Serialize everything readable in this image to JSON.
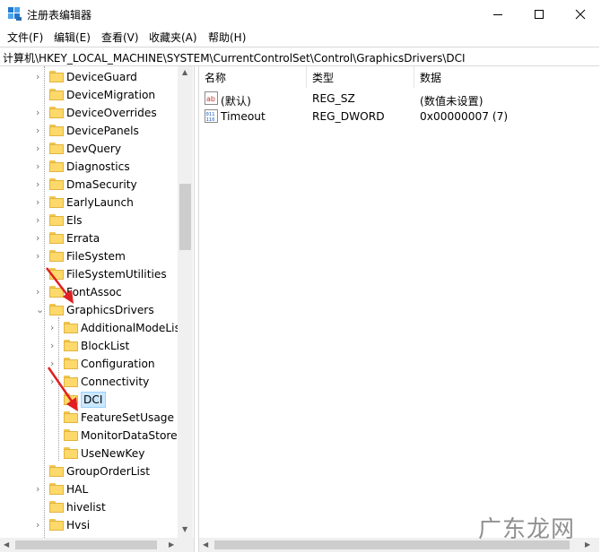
{
  "window": {
    "title": "注册表编辑器",
    "icon": "regedit-icon",
    "controls": [
      "minimize-icon",
      "maximize-icon",
      "close-icon"
    ]
  },
  "menu": [
    "文件(F)",
    "编辑(E)",
    "查看(V)",
    "收藏夹(A)",
    "帮助(H)"
  ],
  "address": "计算机\\HKEY_LOCAL_MACHINE\\SYSTEM\\CurrentControlSet\\Control\\GraphicsDrivers\\DCI",
  "tree": [
    {
      "label": "DeviceGuard",
      "level": 1,
      "expander": "collapsed"
    },
    {
      "label": "DeviceMigration",
      "level": 1,
      "expander": "none"
    },
    {
      "label": "DeviceOverrides",
      "level": 1,
      "expander": "collapsed"
    },
    {
      "label": "DevicePanels",
      "level": 1,
      "expander": "collapsed"
    },
    {
      "label": "DevQuery",
      "level": 1,
      "expander": "collapsed"
    },
    {
      "label": "Diagnostics",
      "level": 1,
      "expander": "collapsed"
    },
    {
      "label": "DmaSecurity",
      "level": 1,
      "expander": "collapsed"
    },
    {
      "label": "EarlyLaunch",
      "level": 1,
      "expander": "collapsed"
    },
    {
      "label": "Els",
      "level": 1,
      "expander": "collapsed"
    },
    {
      "label": "Errata",
      "level": 1,
      "expander": "collapsed"
    },
    {
      "label": "FileSystem",
      "level": 1,
      "expander": "collapsed"
    },
    {
      "label": "FileSystemUtilities",
      "level": 1,
      "expander": "none"
    },
    {
      "label": "FontAssoc",
      "level": 1,
      "expander": "collapsed"
    },
    {
      "label": "GraphicsDrivers",
      "level": 1,
      "expander": "expanded"
    },
    {
      "label": "AdditionalModeLis",
      "level": 2,
      "expander": "collapsed"
    },
    {
      "label": "BlockList",
      "level": 2,
      "expander": "collapsed"
    },
    {
      "label": "Configuration",
      "level": 2,
      "expander": "collapsed"
    },
    {
      "label": "Connectivity",
      "level": 2,
      "expander": "collapsed"
    },
    {
      "label": "DCI",
      "level": 2,
      "expander": "none",
      "selected": true
    },
    {
      "label": "FeatureSetUsage",
      "level": 2,
      "expander": "none"
    },
    {
      "label": "MonitorDataStore",
      "level": 2,
      "expander": "none"
    },
    {
      "label": "UseNewKey",
      "level": 2,
      "expander": "none"
    },
    {
      "label": "GroupOrderList",
      "level": 1,
      "expander": "none"
    },
    {
      "label": "HAL",
      "level": 1,
      "expander": "collapsed"
    },
    {
      "label": "hivelist",
      "level": 1,
      "expander": "none"
    },
    {
      "label": "Hvsi",
      "level": 1,
      "expander": "collapsed"
    }
  ],
  "list": {
    "columns": [
      "名称",
      "类型",
      "数据"
    ],
    "rows": [
      {
        "name": "(默认)",
        "type": "REG_SZ",
        "data": "(数值未设置)",
        "icon": "string-value-icon"
      },
      {
        "name": "Timeout",
        "type": "REG_DWORD",
        "data": "0x00000007 (7)",
        "icon": "binary-value-icon"
      }
    ]
  },
  "watermark": "广东龙网",
  "colors": {
    "selection": "#cce8ff",
    "folder": "#fcd96a",
    "annotation_arrow": "#e02020"
  }
}
